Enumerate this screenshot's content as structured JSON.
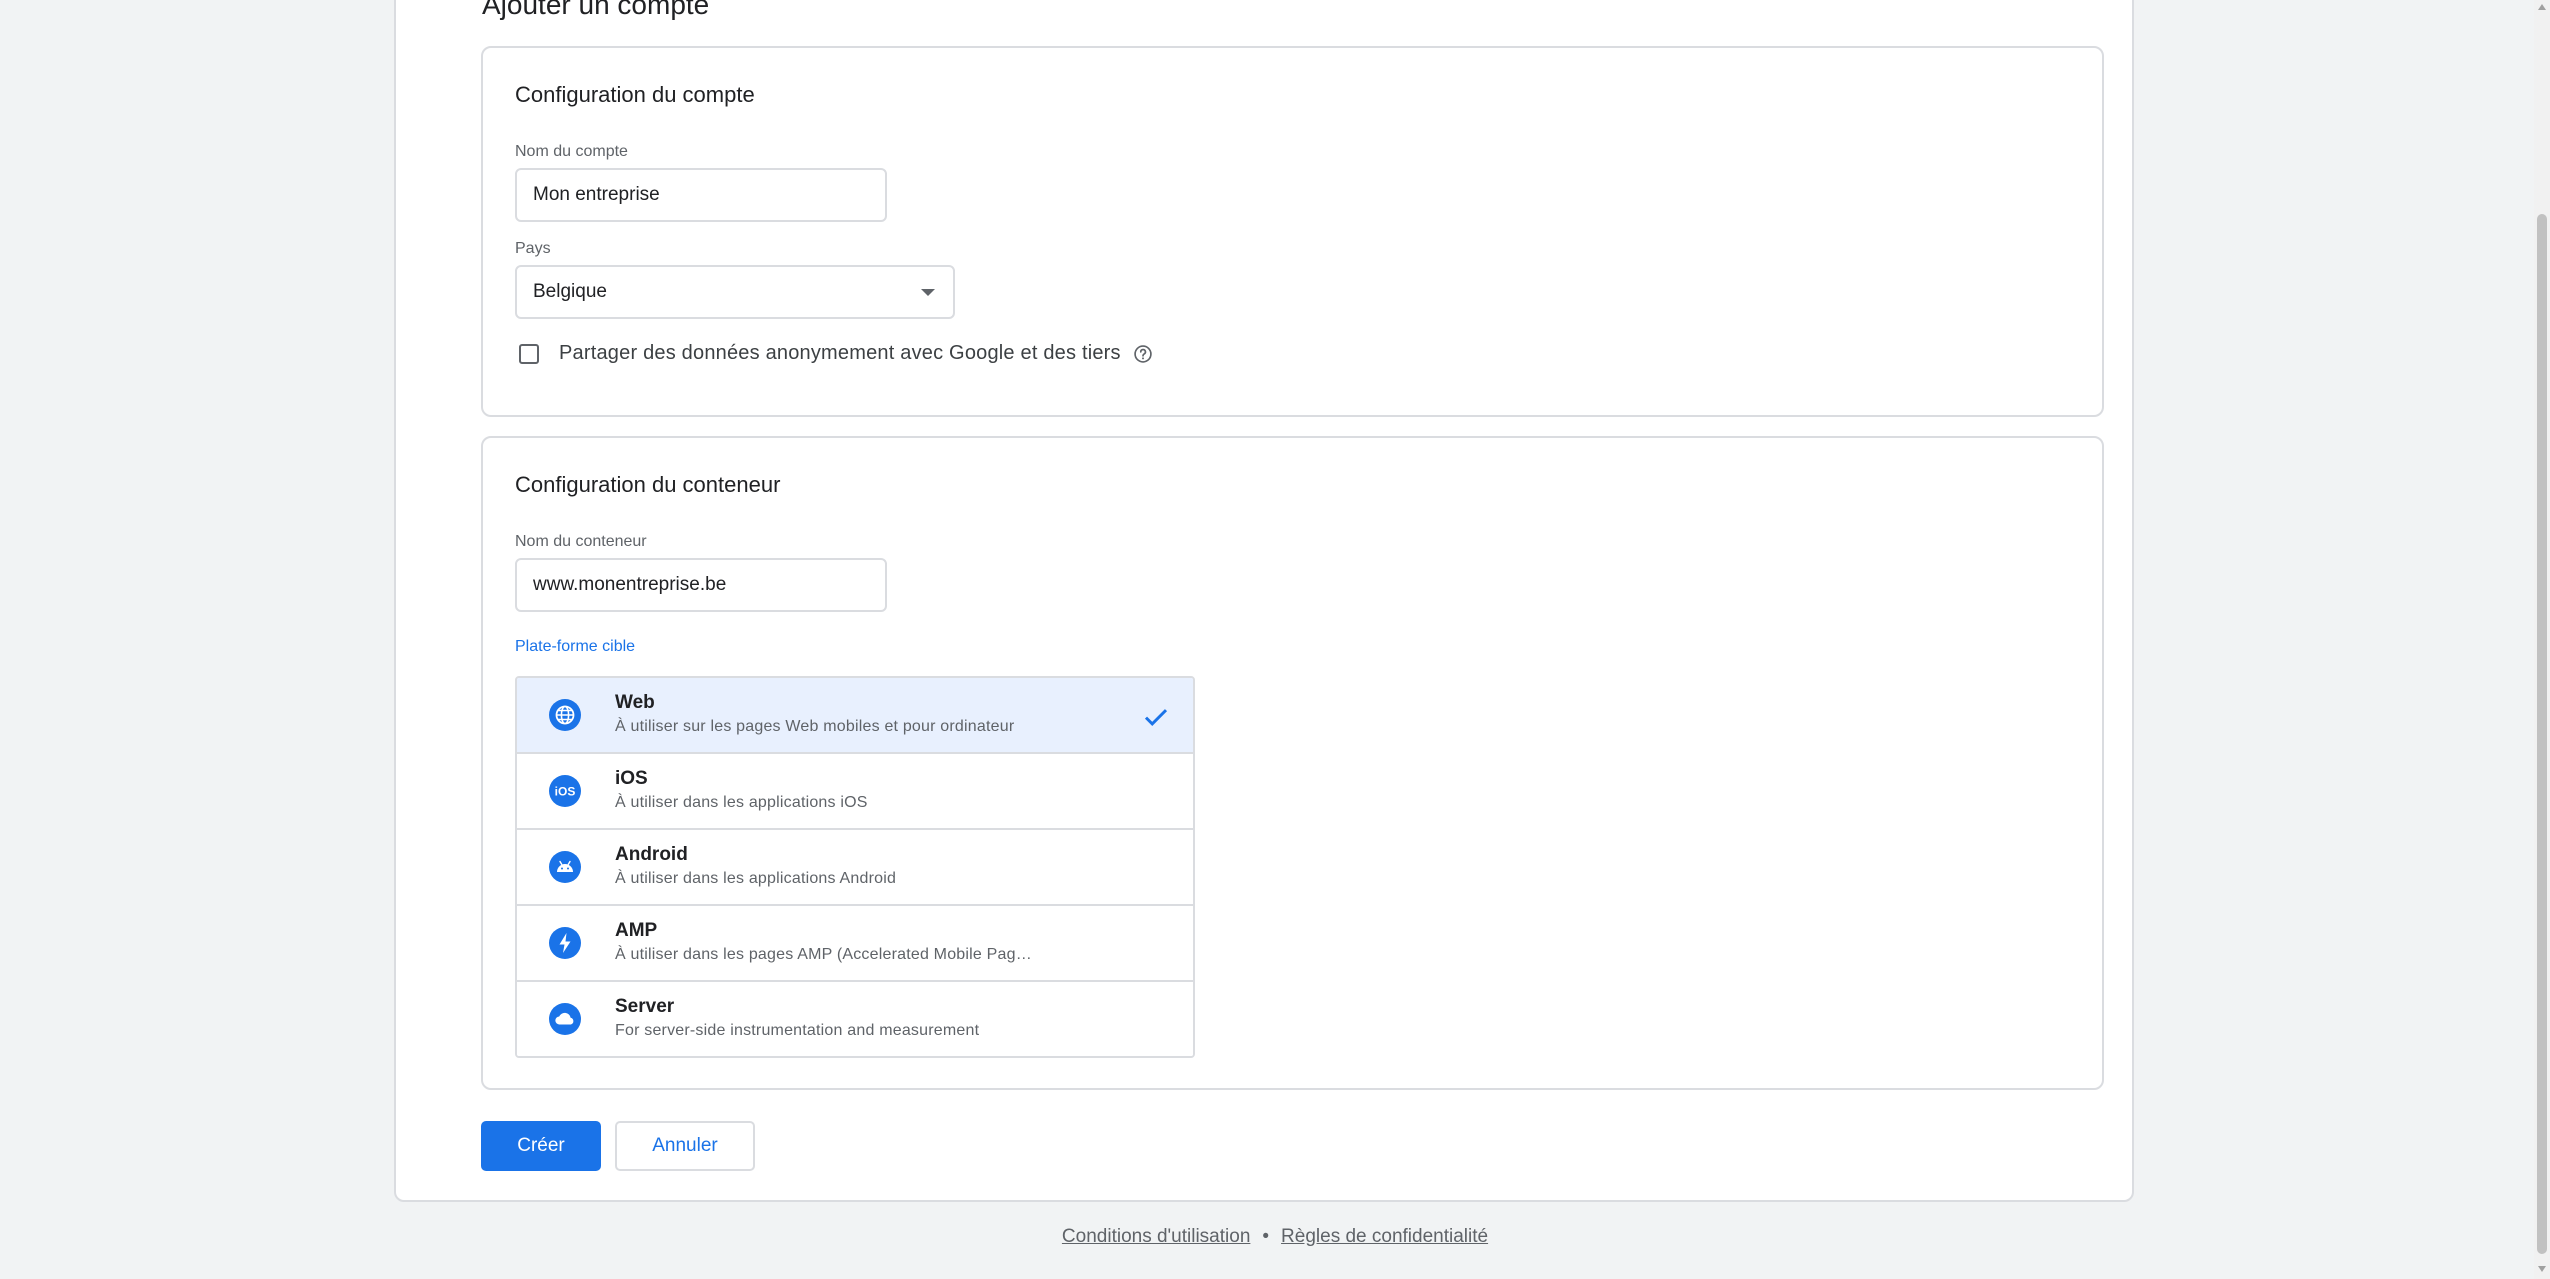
{
  "page": {
    "title": "Ajouter un compte"
  },
  "account": {
    "section_title": "Configuration du compte",
    "name_label": "Nom du compte",
    "name_value": "Mon entreprise",
    "country_label": "Pays",
    "country_value": "Belgique",
    "share_label": "Partager des données anonymement avec Google et des tiers",
    "share_checked": false
  },
  "container": {
    "section_title": "Configuration du conteneur",
    "name_label": "Nom du conteneur",
    "name_value": "www.monentreprise.be",
    "platform_label": "Plate-forme cible",
    "platforms": [
      {
        "name": "Web",
        "desc": "À utiliser sur les pages Web mobiles et pour ordinateur",
        "icon": "globe-icon",
        "selected": true
      },
      {
        "name": "iOS",
        "desc": "À utiliser dans les applications iOS",
        "icon": "ios-icon",
        "selected": false
      },
      {
        "name": "Android",
        "desc": "À utiliser dans les applications Android",
        "icon": "android-icon",
        "selected": false
      },
      {
        "name": "AMP",
        "desc": "À utiliser dans les pages AMP (Accelerated Mobile Pag…",
        "icon": "lightning-icon",
        "selected": false
      },
      {
        "name": "Server",
        "desc": "For server-side instrumentation and measurement",
        "icon": "cloud-icon",
        "selected": false
      }
    ]
  },
  "actions": {
    "create_label": "Créer",
    "cancel_label": "Annuler"
  },
  "footer": {
    "terms_label": "Conditions d'utilisation",
    "separator": "•",
    "privacy_label": "Règles de confidentialité"
  },
  "colors": {
    "accent": "#1a73e8",
    "selected_bg": "#e8f0fe",
    "border": "#dadce0"
  }
}
